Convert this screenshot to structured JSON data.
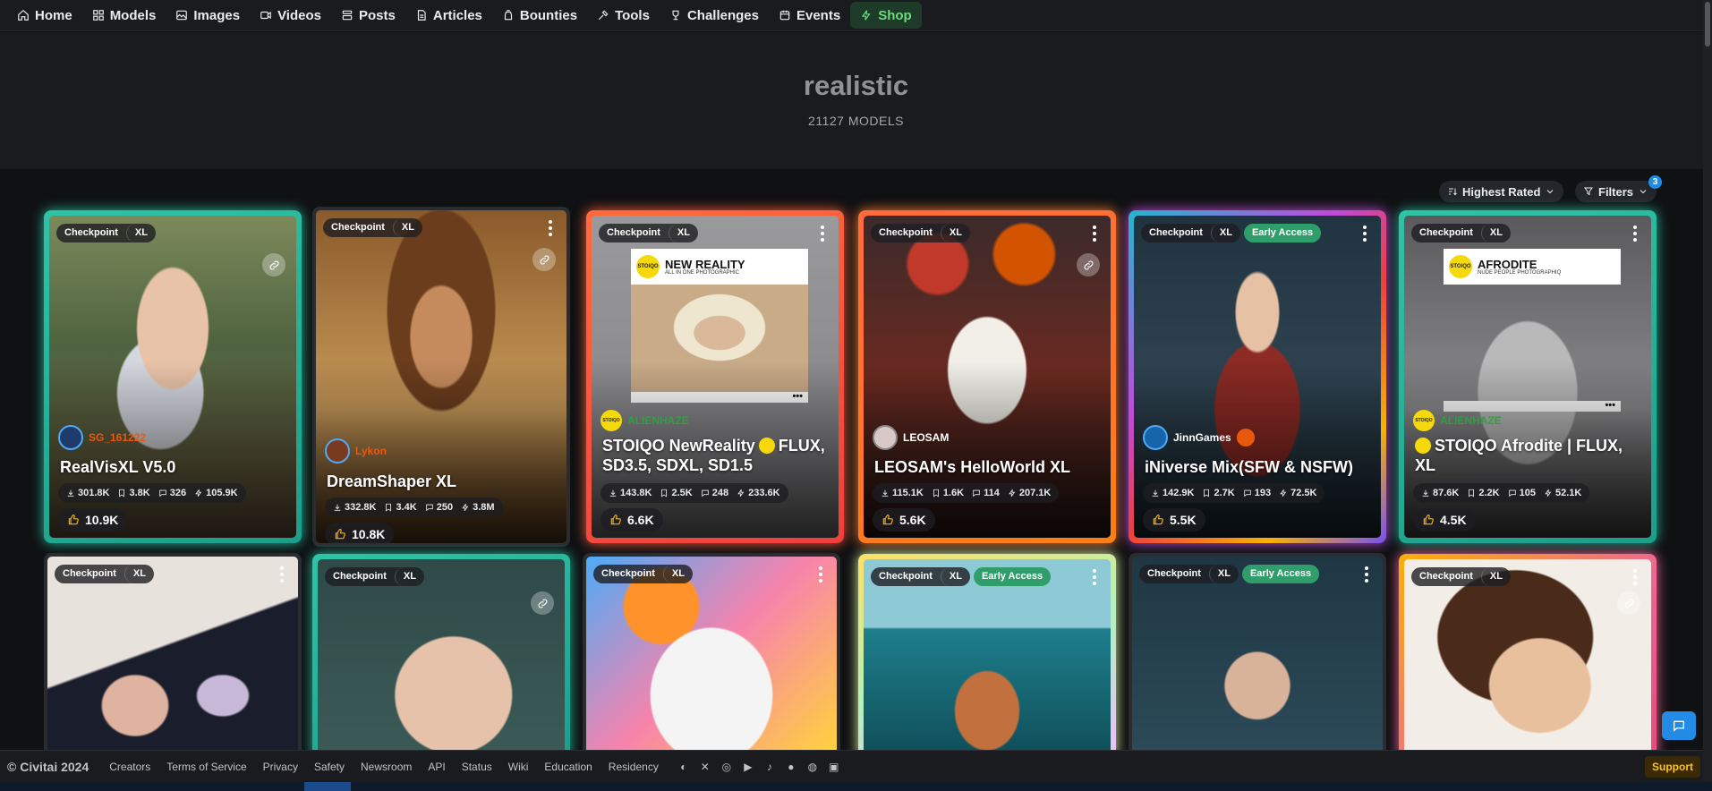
{
  "nav": {
    "items": [
      {
        "label": "Home",
        "icon": "home-icon"
      },
      {
        "label": "Models",
        "icon": "grid-icon"
      },
      {
        "label": "Images",
        "icon": "image-icon"
      },
      {
        "label": "Videos",
        "icon": "video-icon"
      },
      {
        "label": "Posts",
        "icon": "posts-icon"
      },
      {
        "label": "Articles",
        "icon": "article-icon"
      },
      {
        "label": "Bounties",
        "icon": "bounty-icon"
      },
      {
        "label": "Tools",
        "icon": "tools-icon"
      },
      {
        "label": "Challenges",
        "icon": "trophy-icon"
      },
      {
        "label": "Events",
        "icon": "calendar-icon"
      },
      {
        "label": "Shop",
        "icon": "bolt-icon"
      }
    ]
  },
  "header": {
    "title": "realistic",
    "subtitle": "21127 MODELS"
  },
  "toolbar": {
    "sort_label": "Highest Rated",
    "filters_label": "Filters",
    "filters_count": "3"
  },
  "cards": [
    {
      "type": "Checkpoint",
      "base": "XL",
      "early": "",
      "creator": "SG_161222",
      "title": "RealVisXL V5.0",
      "downloads": "301.8K",
      "collects": "3.8K",
      "comments": "326",
      "buzz": "105.9K",
      "likes": "10.9K"
    },
    {
      "type": "Checkpoint",
      "base": "XL",
      "early": "",
      "creator": "Lykon",
      "title": "DreamShaper XL",
      "downloads": "332.8K",
      "collects": "3.4K",
      "comments": "250",
      "buzz": "3.8M",
      "likes": "10.8K"
    },
    {
      "type": "Checkpoint",
      "base": "XL",
      "early": "",
      "creator": "ALIENHAZE",
      "title_a": "STOIQO NewReality",
      "title_b": "FLUX, SD3.5, SDXL, SD1.5",
      "sponsor_name": "NEW REALITY",
      "sponsor_slogan": "ALL IN ONE PHOTOGRAPHIC",
      "sponsor_logo": "STOIQO",
      "downloads": "143.8K",
      "collects": "2.5K",
      "comments": "248",
      "buzz": "233.6K",
      "likes": "6.6K"
    },
    {
      "type": "Checkpoint",
      "base": "XL",
      "early": "",
      "creator": "LEOSAM",
      "title": "LEOSAM's HelloWorld XL",
      "downloads": "115.1K",
      "collects": "1.6K",
      "comments": "114",
      "buzz": "207.1K",
      "likes": "5.6K"
    },
    {
      "type": "Checkpoint",
      "base": "XL",
      "early": "Early Access",
      "creator": "JinnGames",
      "title": "iNiverse Mix(SFW & NSFW)",
      "downloads": "142.9K",
      "collects": "2.7K",
      "comments": "193",
      "buzz": "72.5K",
      "likes": "5.5K"
    },
    {
      "type": "Checkpoint",
      "base": "XL",
      "early": "",
      "creator": "ALIENHAZE",
      "title_a": "STOIQO Afrodite | FLUX,",
      "title_b": "XL",
      "sponsor_name": "AFRODITE",
      "sponsor_slogan": "NUDE PEOPLE PHOTOGRAPHIQ",
      "sponsor_logo": "STOIQO",
      "downloads": "87.6K",
      "collects": "2.2K",
      "comments": "105",
      "buzz": "52.1K",
      "likes": "4.5K"
    }
  ],
  "row2": [
    {
      "type": "Checkpoint",
      "base": "XL",
      "early": ""
    },
    {
      "type": "Checkpoint",
      "base": "XL",
      "early": ""
    },
    {
      "type": "Checkpoint",
      "base": "XL",
      "early": ""
    },
    {
      "type": "Checkpoint",
      "base": "XL",
      "early": "Early Access"
    },
    {
      "type": "Checkpoint",
      "base": "XL",
      "early": "Early Access"
    },
    {
      "type": "Checkpoint",
      "base": "XL",
      "early": ""
    }
  ],
  "footer": {
    "copyright": "© Civitai 2024",
    "links": [
      "Creators",
      "Terms of Service",
      "Privacy",
      "Safety",
      "Newsroom",
      "API",
      "Status",
      "Wiki",
      "Education",
      "Residency"
    ],
    "social": [
      "discord-icon",
      "x-icon",
      "instagram-icon",
      "youtube-icon",
      "tiktok-icon",
      "reddit-icon",
      "github-icon",
      "twitch-icon"
    ],
    "support_label": "Support"
  },
  "colors": {
    "accent": "#228be6",
    "shop": "#69db7c",
    "early_access": "#2f9e6b",
    "likes": "#fab005"
  }
}
